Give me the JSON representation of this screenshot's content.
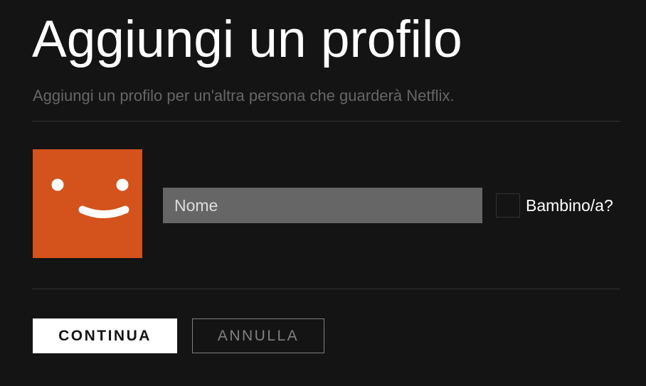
{
  "header": {
    "title": "Aggiungi un profilo",
    "subtitle": "Aggiungi un profilo per un'altra persona che guarderà Netflix."
  },
  "profile": {
    "avatar_icon": "smiley-face-icon",
    "avatar_color": "#d4521b",
    "name_input": {
      "placeholder": "Nome",
      "value": ""
    },
    "kid_checkbox": {
      "label": "Bambino/a?",
      "checked": false
    }
  },
  "actions": {
    "continue_label": "CONTINUA",
    "cancel_label": "ANNULLA"
  },
  "colors": {
    "background": "#141414",
    "input_background": "#666666",
    "primary_button": "#ffffff",
    "secondary_text": "#666666"
  }
}
